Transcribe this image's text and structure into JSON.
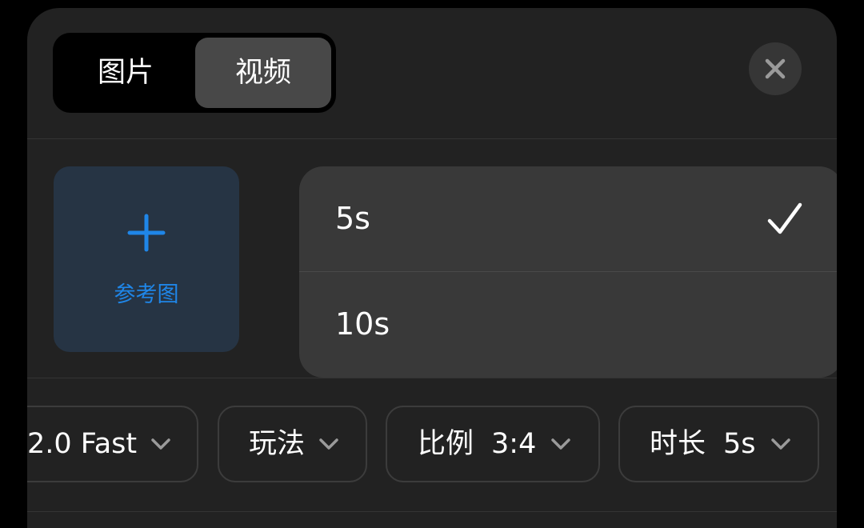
{
  "tabs": {
    "image_label": "图片",
    "video_label": "视频",
    "selected": "视频"
  },
  "close_icon": "close-icon",
  "reference": {
    "icon": "plus-icon",
    "label": "参考图",
    "accent": "#1f86e8"
  },
  "duration_menu": {
    "options": [
      {
        "label": "5s",
        "selected": true
      },
      {
        "label": "10s",
        "selected": false
      }
    ]
  },
  "chips": {
    "model": {
      "value": "2.0 Fast"
    },
    "play": {
      "label": "玩法"
    },
    "ratio": {
      "label": "比例",
      "value": "3:4"
    },
    "duration": {
      "label": "时长",
      "value": "5s"
    }
  }
}
